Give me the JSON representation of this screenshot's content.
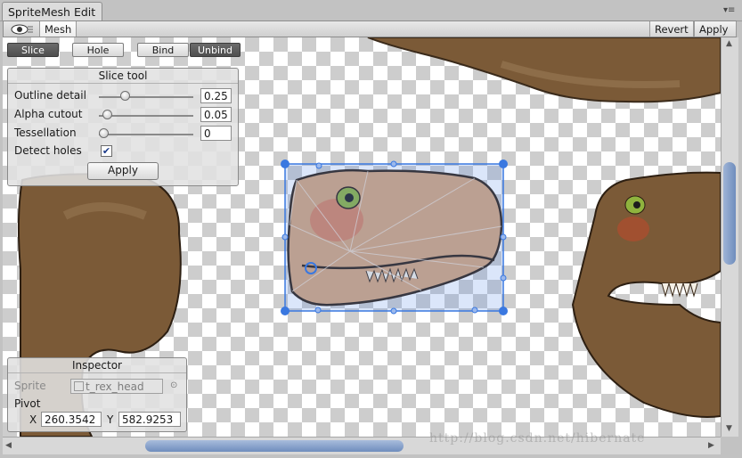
{
  "window": {
    "title": "SpriteMesh Edit"
  },
  "toolbar": {
    "tab_label": "Mesh",
    "revert_label": "Revert",
    "apply_label": "Apply",
    "eye_icon": "eye-icon"
  },
  "modes": {
    "slice": "Slice",
    "hole": "Hole",
    "bind": "Bind",
    "unbind": "Unbind",
    "active": "Slice"
  },
  "slice_tool": {
    "title": "Slice tool",
    "outline_detail": {
      "label": "Outline detail",
      "value": "0.25",
      "fraction": 0.25
    },
    "alpha_cutout": {
      "label": "Alpha cutout",
      "value": "0.05",
      "fraction": 0.05
    },
    "tessellation": {
      "label": "Tessellation",
      "value": "0",
      "fraction": 0
    },
    "detect_holes": {
      "label": "Detect holes",
      "checked": true
    },
    "apply_label": "Apply"
  },
  "inspector": {
    "title": "Inspector",
    "sprite_label": "Sprite",
    "sprite_value": "t_rex_head",
    "pivot_label": "Pivot",
    "pivot_x_label": "X",
    "pivot_x": "260.3542",
    "pivot_y_label": "Y",
    "pivot_y": "582.9253"
  },
  "watermark": "http://blog.csdn.net/hibernate",
  "colors": {
    "selection": "#3a78e0",
    "active_button": "#555555",
    "skin": "#7b5a37",
    "head": "#d7a67a"
  }
}
